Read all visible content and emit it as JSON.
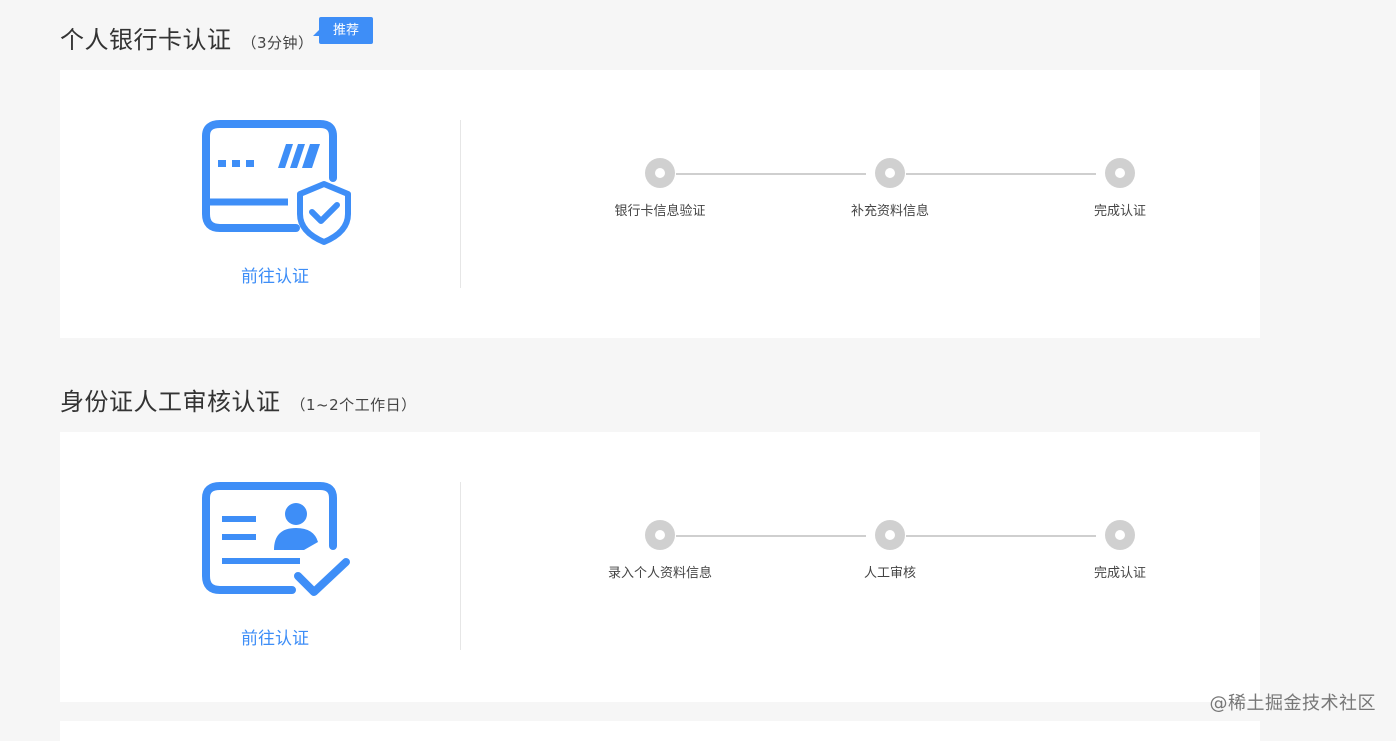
{
  "sections": [
    {
      "title": "个人银行卡认证",
      "duration": "（3分钟）",
      "badge": "推荐",
      "icon": "bank-card-shield-icon",
      "action_label": "前往认证",
      "steps": [
        {
          "label": "银行卡信息验证"
        },
        {
          "label": "补充资料信息"
        },
        {
          "label": "完成认证"
        }
      ]
    },
    {
      "title": "身份证人工审核认证",
      "duration": "（1~2个工作日）",
      "icon": "id-card-check-icon",
      "action_label": "前往认证",
      "steps": [
        {
          "label": "录入个人资料信息"
        },
        {
          "label": "人工审核"
        },
        {
          "label": "完成认证"
        }
      ]
    }
  ],
  "colors": {
    "accent": "#3e8ef7",
    "step_inactive": "#d0d0d0",
    "background": "#f6f6f6"
  },
  "watermark": "@稀土掘金技术社区"
}
